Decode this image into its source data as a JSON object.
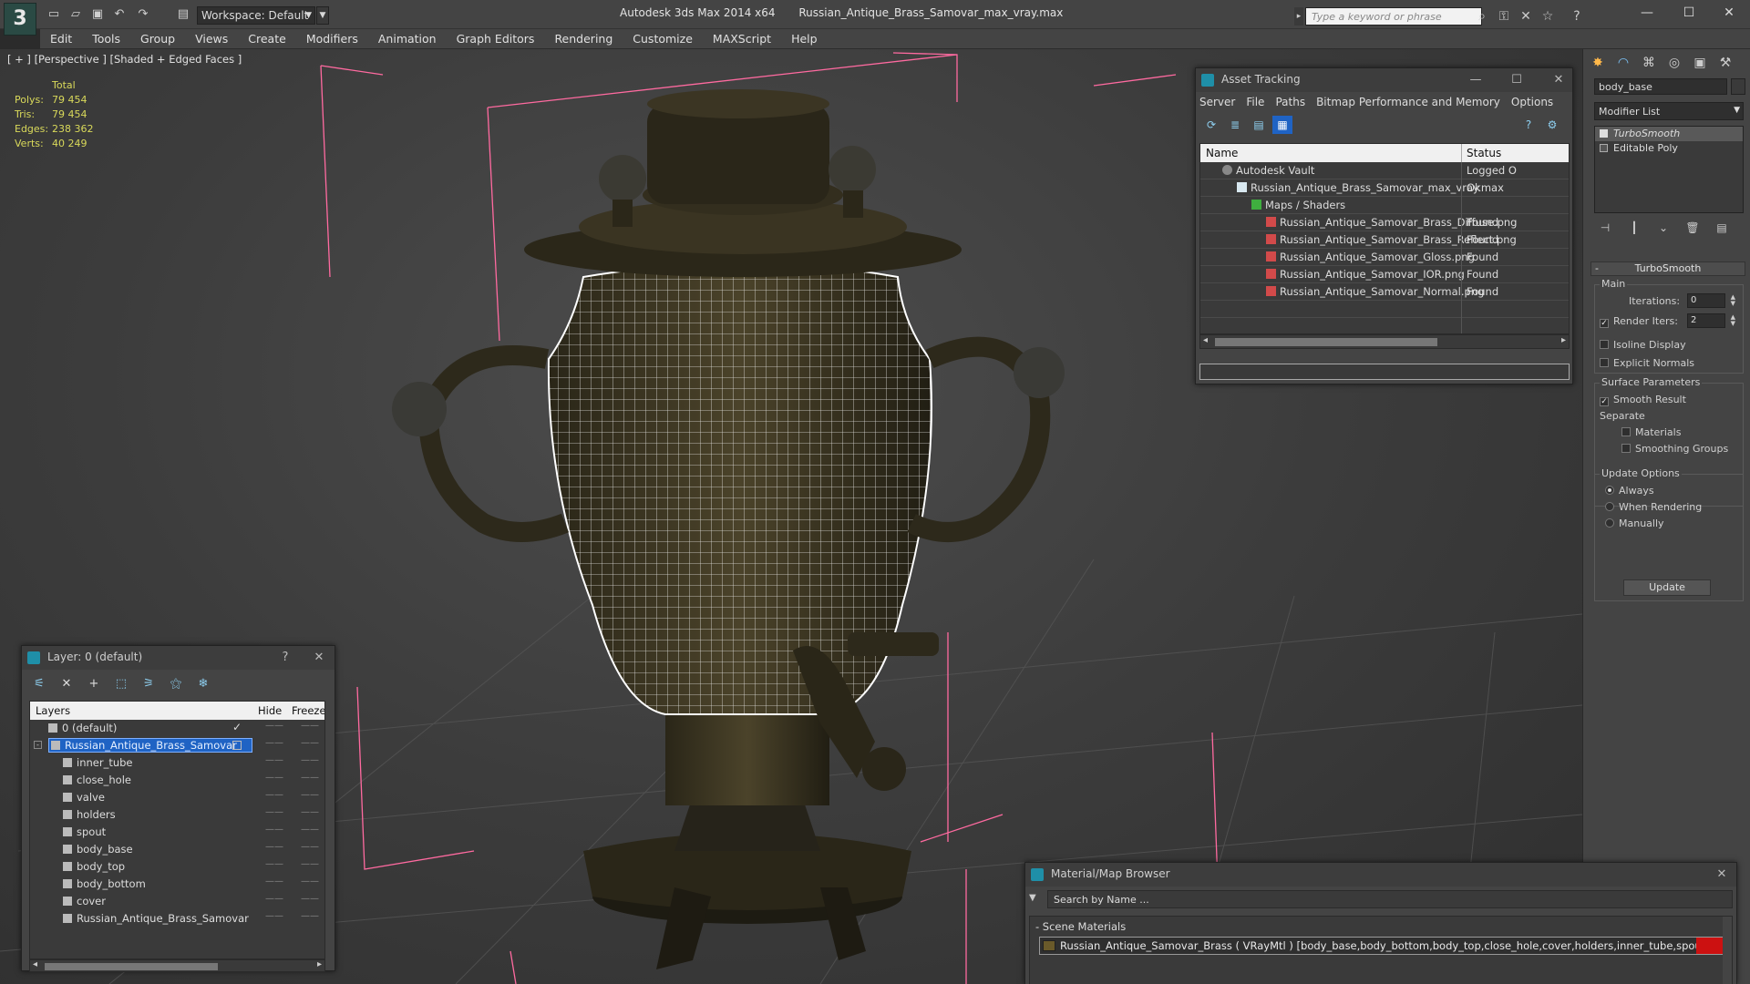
{
  "titlebar": {
    "workspace": "Workspace: Default",
    "app_title": "Autodesk 3ds Max  2014 x64",
    "file_title": "Russian_Antique_Brass_Samovar_max_vray.max",
    "search_placeholder": "Type a keyword or phrase",
    "window_controls": [
      "minimize-icon",
      "maximize-icon",
      "close-icon"
    ]
  },
  "menubar": {
    "items": [
      "Edit",
      "Tools",
      "Group",
      "Views",
      "Create",
      "Modifiers",
      "Animation",
      "Graph Editors",
      "Rendering",
      "Customize",
      "MAXScript",
      "Help"
    ]
  },
  "viewport": {
    "label": "[ + ] [Perspective ] [Shaded + Edged Faces ]",
    "stats": {
      "header": "Total",
      "rows": [
        {
          "label": "Polys:",
          "value": "79 454"
        },
        {
          "label": "Tris:",
          "value": "79 454"
        },
        {
          "label": "Edges:",
          "value": "238 362"
        },
        {
          "label": "Verts:",
          "value": "40 249"
        }
      ]
    }
  },
  "command_panel": {
    "object_name": "body_base",
    "modifier_list": "Modifier List",
    "stack": [
      "TurboSmooth",
      "Editable Poly"
    ],
    "rollout_title": "TurboSmooth",
    "main_group": "Main",
    "iterations_label": "Iterations:",
    "iterations_value": "0",
    "render_iters_label": "Render Iters:",
    "render_iters_value": "2",
    "isoline_display": "Isoline Display",
    "explicit_normals": "Explicit Normals",
    "surface_group": "Surface Parameters",
    "smooth_result": "Smooth Result",
    "separate_label": "Separate",
    "materials": "Materials",
    "smoothing_groups": "Smoothing Groups",
    "update_group": "Update Options",
    "always": "Always",
    "when_rendering": "When Rendering",
    "manually": "Manually",
    "update_button": "Update"
  },
  "asset_tracking": {
    "title": "Asset Tracking",
    "menu": [
      "Server",
      "File",
      "Paths",
      "Bitmap Performance and Memory",
      "Options"
    ],
    "columns": {
      "name": "Name",
      "status": "Status"
    },
    "rows": [
      {
        "name": "Autodesk Vault",
        "status": "Logged O",
        "indent": 1
      },
      {
        "name": "Russian_Antique_Brass_Samovar_max_vray.max",
        "status": "Ok",
        "indent": 2
      },
      {
        "name": "Maps / Shaders",
        "status": "",
        "indent": 3
      },
      {
        "name": "Russian_Antique_Samovar_Brass_Diffuse.png",
        "status": "Found",
        "indent": 4
      },
      {
        "name": "Russian_Antique_Samovar_Brass_Reflect.png",
        "status": "Found",
        "indent": 4
      },
      {
        "name": "Russian_Antique_Samovar_Gloss.png",
        "status": "Found",
        "indent": 4
      },
      {
        "name": "Russian_Antique_Samovar_IOR.png",
        "status": "Found",
        "indent": 4
      },
      {
        "name": "Russian_Antique_Samovar_Normal.png",
        "status": "Found",
        "indent": 4
      }
    ]
  },
  "layer_window": {
    "title": "Layer: 0 (default)",
    "help": "?",
    "columns": {
      "layers": "Layers",
      "hide": "Hide",
      "freeze": "Freeze"
    },
    "rows": [
      {
        "name": "0 (default)",
        "indent": 1
      },
      {
        "name": "Russian_Antique_Brass_Samovar",
        "indent": 1,
        "selected": true
      },
      {
        "name": "inner_tube",
        "indent": 2
      },
      {
        "name": "close_hole",
        "indent": 2
      },
      {
        "name": "valve",
        "indent": 2
      },
      {
        "name": "holders",
        "indent": 2
      },
      {
        "name": "spout",
        "indent": 2
      },
      {
        "name": "body_base",
        "indent": 2
      },
      {
        "name": "body_top",
        "indent": 2
      },
      {
        "name": "body_bottom",
        "indent": 2
      },
      {
        "name": "cover",
        "indent": 2
      },
      {
        "name": "Russian_Antique_Brass_Samovar",
        "indent": 2
      }
    ]
  },
  "material_browser": {
    "title": "Material/Map Browser",
    "search_placeholder": "Search by Name ...",
    "group": "- Scene Materials",
    "item": "Russian_Antique_Samovar_Brass ( VRayMtl ) [body_base,body_bottom,body_top,close_hole,cover,holders,inner_tube,spout,valve]",
    "swatch_color": "#cc1111"
  },
  "colors": {
    "selection": "#1f63c4",
    "stats_text": "#d9d95a",
    "wireframe": "#ffffff",
    "bounding_box": "#ff6aa0"
  }
}
